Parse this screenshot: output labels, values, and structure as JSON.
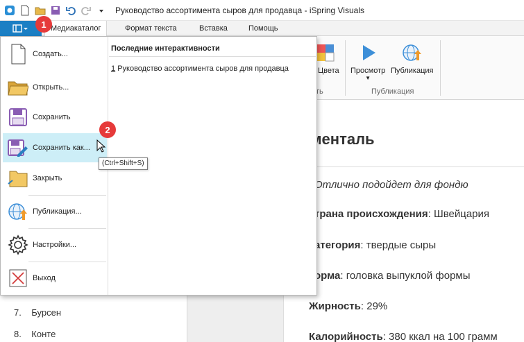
{
  "window": {
    "title": "Руководство ассортимента сыров для продавца - iSpring Visuals"
  },
  "ribbon": {
    "tabs": [
      {
        "label": "Медиакаталог",
        "active": true
      },
      {
        "label": "Формат текста",
        "active": false
      },
      {
        "label": "Вставка",
        "active": false
      },
      {
        "label": "Помощь",
        "active": false
      }
    ],
    "colors_label": "Цвета",
    "preview_label": "Просмотр",
    "publish_label": "Публикация",
    "group_publish_label": "Публикация",
    "group_partial_label": "ть"
  },
  "file_menu": {
    "items": [
      {
        "label": "Создать...",
        "icon": "new-document-icon"
      },
      {
        "label": "Открыть...",
        "icon": "open-folder-icon"
      },
      {
        "label": "Сохранить",
        "icon": "save-icon"
      },
      {
        "label": "Сохранить как...",
        "icon": "save-as-icon"
      },
      {
        "label": "Закрыть",
        "icon": "close-folder-icon"
      },
      {
        "label": "Публикация...",
        "icon": "publish-icon"
      },
      {
        "label": "Настройки...",
        "icon": "gear-icon"
      },
      {
        "label": "Выход",
        "icon": "exit-icon"
      }
    ],
    "recent_title": "Последние интерактивности",
    "recent_items": [
      {
        "number": "1",
        "label": "Руководство ассортимента сыров для продавца"
      }
    ]
  },
  "tooltip": {
    "text": "(Ctrl+Shift+S)"
  },
  "badges": [
    "1",
    "2"
  ],
  "document": {
    "title": "мменталь",
    "lines": [
      {
        "bold": "",
        "text": "Отлично подойдет для фондю",
        "italic": true
      },
      {
        "bold": "трана происхождения",
        "text": ": Швейцария"
      },
      {
        "bold": "атегория",
        "text": ": твердые сыры"
      },
      {
        "bold": "орма",
        "text": ": головка выпуклой формы"
      },
      {
        "bold": "Жирность",
        "text": ": 29%"
      },
      {
        "bold": "Калорийность",
        "text": ": 380 ккал на 100 грамм"
      }
    ]
  },
  "list": [
    {
      "number": "7.",
      "label": "Бурсен"
    },
    {
      "number": "8.",
      "label": "Конте"
    }
  ],
  "colors": {
    "accent": "#1b7fc4",
    "badge": "#e63a3a",
    "hover": "#cdeef7"
  }
}
